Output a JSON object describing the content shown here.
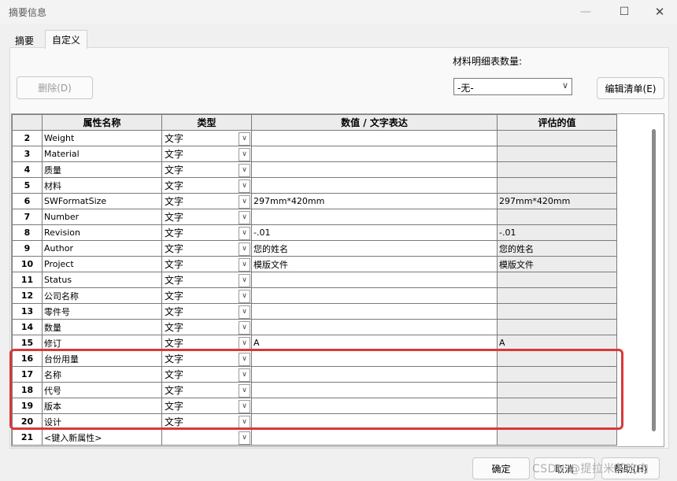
{
  "window": {
    "title": "摘要信息"
  },
  "tabs": [
    {
      "label": "摘要"
    },
    {
      "label": "自定义"
    }
  ],
  "toolbar": {
    "delete_label": "删除(D)",
    "bom_label": "材料明细表数量:",
    "bom_value": "-无-",
    "edit_label": "编辑清单(E)"
  },
  "grid": {
    "headers": {
      "name": "属性名称",
      "type": "类型",
      "value": "数值 / 文字表达",
      "eval": "评估的值"
    },
    "rows": [
      {
        "num": "2",
        "name": "Weight",
        "type": "文字",
        "value": "",
        "eval": ""
      },
      {
        "num": "3",
        "name": "Material",
        "type": "文字",
        "value": "",
        "eval": ""
      },
      {
        "num": "4",
        "name": "质量",
        "type": "文字",
        "value": "",
        "eval": ""
      },
      {
        "num": "5",
        "name": "材料",
        "type": "文字",
        "value": "",
        "eval": ""
      },
      {
        "num": "6",
        "name": "SWFormatSize",
        "type": "文字",
        "value": "297mm*420mm",
        "eval": "297mm*420mm"
      },
      {
        "num": "7",
        "name": "Number",
        "type": "文字",
        "value": "",
        "eval": ""
      },
      {
        "num": "8",
        "name": "Revision",
        "type": "文字",
        "value": "-.01",
        "eval": "-.01"
      },
      {
        "num": "9",
        "name": "Author",
        "type": "文字",
        "value": "您的姓名",
        "eval": "您的姓名"
      },
      {
        "num": "10",
        "name": "Project",
        "type": "文字",
        "value": "模版文件",
        "eval": "模版文件"
      },
      {
        "num": "11",
        "name": "Status",
        "type": "文字",
        "value": "",
        "eval": ""
      },
      {
        "num": "12",
        "name": "公司名称",
        "type": "文字",
        "value": "",
        "eval": ""
      },
      {
        "num": "13",
        "name": "零件号",
        "type": "文字",
        "value": "",
        "eval": ""
      },
      {
        "num": "14",
        "name": "数量",
        "type": "文字",
        "value": "",
        "eval": ""
      },
      {
        "num": "15",
        "name": "修订",
        "type": "文字",
        "value": "A",
        "eval": "A"
      },
      {
        "num": "16",
        "name": "台份用量",
        "type": "文字",
        "value": "",
        "eval": ""
      },
      {
        "num": "17",
        "name": "名称",
        "type": "文字",
        "value": "",
        "eval": ""
      },
      {
        "num": "18",
        "name": "代号",
        "type": "文字",
        "value": "",
        "eval": ""
      },
      {
        "num": "19",
        "name": "版本",
        "type": "文字",
        "value": "",
        "eval": ""
      },
      {
        "num": "20",
        "name": "设计",
        "type": "文字",
        "value": "",
        "eval": ""
      },
      {
        "num": "21",
        "name": "<键入新属性>",
        "type": "",
        "value": "",
        "eval": ""
      }
    ]
  },
  "footer": {
    "ok_label": "确定",
    "cancel_label": "取消",
    "help_label": "帮助(H)"
  },
  "watermark": "CSDN @提拉米苏吃肉",
  "colors": {
    "highlight": "#d8393b",
    "header_bg": "#ececec",
    "eval_bg": "#ececec"
  }
}
